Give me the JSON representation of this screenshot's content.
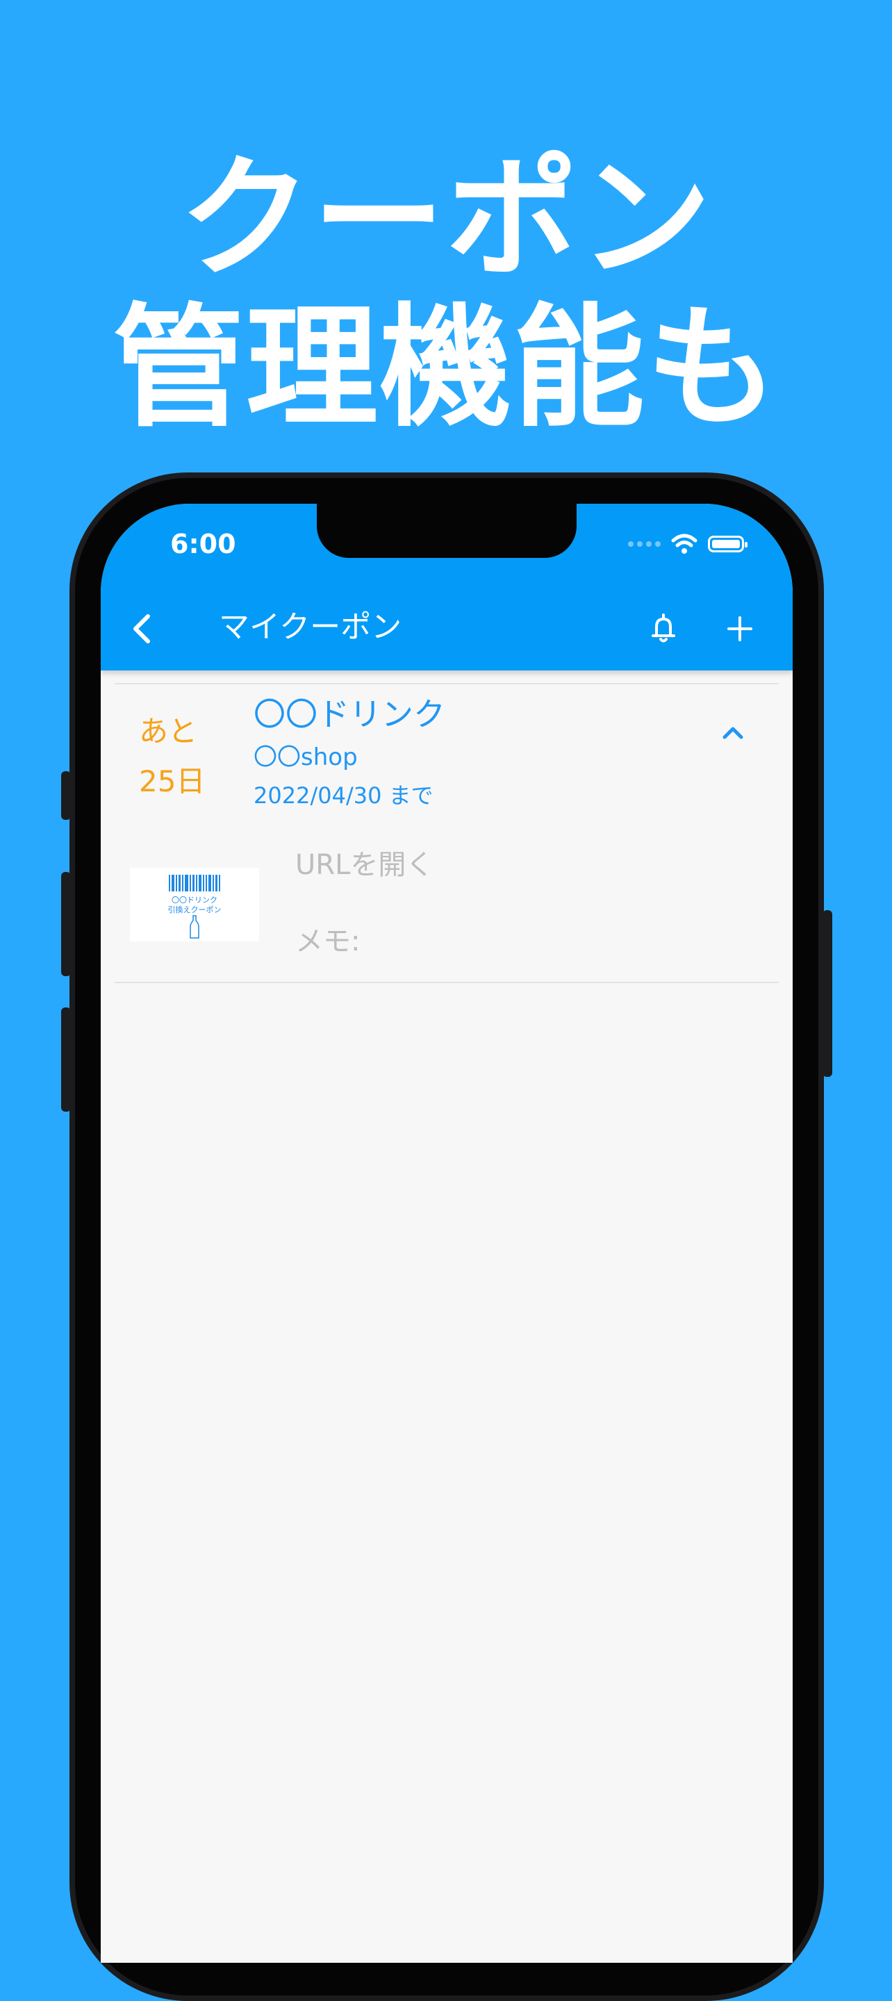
{
  "headline": {
    "line1": "クーポン",
    "line2": "管理機能も"
  },
  "status_bar": {
    "time": "6:00"
  },
  "app_bar": {
    "title": "マイクーポン",
    "add_label": "+"
  },
  "coupon": {
    "days_prefix": "あと",
    "days_left": "25日",
    "name": "〇〇ドリンク",
    "shop": "〇〇shop",
    "expiry": "2022/04/30 まで",
    "thumbnail_line1": "〇〇ドリンク",
    "thumbnail_line2": "引換えクーポン",
    "link_label": "URLを開く",
    "memo_label": "メモ:"
  },
  "colors": {
    "background": "#29a9fd",
    "app_bar": "#039bf7",
    "accent_blue": "#2196f3",
    "days_orange": "#f5a31a",
    "muted_text": "#bdbdbd"
  },
  "icons": [
    "back-chevron-icon",
    "bell-icon",
    "plus-icon",
    "chevron-up-icon",
    "wifi-icon",
    "battery-icon",
    "barcode-icon",
    "bottle-icon"
  ]
}
